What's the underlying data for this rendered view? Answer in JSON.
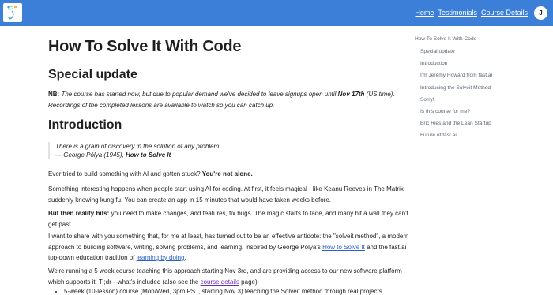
{
  "nav": {
    "links": [
      "Home",
      "Testimonials",
      "Course Details"
    ],
    "avatar_initial": "J"
  },
  "page": {
    "title": "How To Solve It With Code",
    "special_update_heading": "Special update",
    "note": {
      "label": "NB:",
      "text1": " The course has started now, but due to popular demand we've decided to leave signups open until ",
      "date": "Nov 17th",
      "text2": " (US time). Recordings of the completed lessons are available to watch so you can catch up."
    },
    "introduction_heading": "Introduction",
    "quote": {
      "text": "There is a grain of discovery in the solution of any problem.",
      "attribution_prefix": "— George Pólya (1945), ",
      "book": "How to Solve It"
    },
    "p1": {
      "text": "Ever tried to build something with AI and gotten stuck? ",
      "bold": "You're not alone."
    },
    "p2": "Something interesting happens when people start using AI for coding. At first, it feels magical - like Keanu Reeves in The Matrix suddenly knowing kung fu. You can create an app in 15 minutes that would have taken weeks before.",
    "p3": {
      "bold": "But then reality hits:",
      "text": " you need to make changes, add features, fix bugs. The magic starts to fade, and many hit a wall they can't get past."
    },
    "p4": {
      "text1": "I want to share with you something that, for me at least, has turned out to be an effective antidote: the \"solveit method\", a modern approach to building software, writing, solving problems, and learning, inspired by George Pólya's ",
      "link1": "How to Solve It",
      "text2": " and the fast.ai top-down education tradition of ",
      "link2": "learning by doing",
      "text3": "."
    },
    "p5": {
      "text1": "We're running a 5 week course teaching this approach starting Nov 3rd, and are providing access to our new software platform which supports it. Tl;dr—what's included (also see the ",
      "link": "course details",
      "text2": " page):"
    },
    "bullet1": "5-week (10-lesson) course (Mon/Wed, 3pm PST, starting Nov 3) teaching the Solveit method through real projects"
  },
  "toc": {
    "items": [
      "How To Solve It With Code",
      "Special update",
      "Introduction",
      "I'm Jeremy Howard from fast.ai",
      "Introducing the Solveit Method",
      "Sorry!",
      "Is this course for me?",
      "Eric Ries and the Lean Startup",
      "Future of fast.ai"
    ]
  },
  "colors": {
    "navbar": "#3b7fd9",
    "link": "#2a62c9",
    "visited_link": "#6b2fb3",
    "toc_text": "#5b6570"
  }
}
